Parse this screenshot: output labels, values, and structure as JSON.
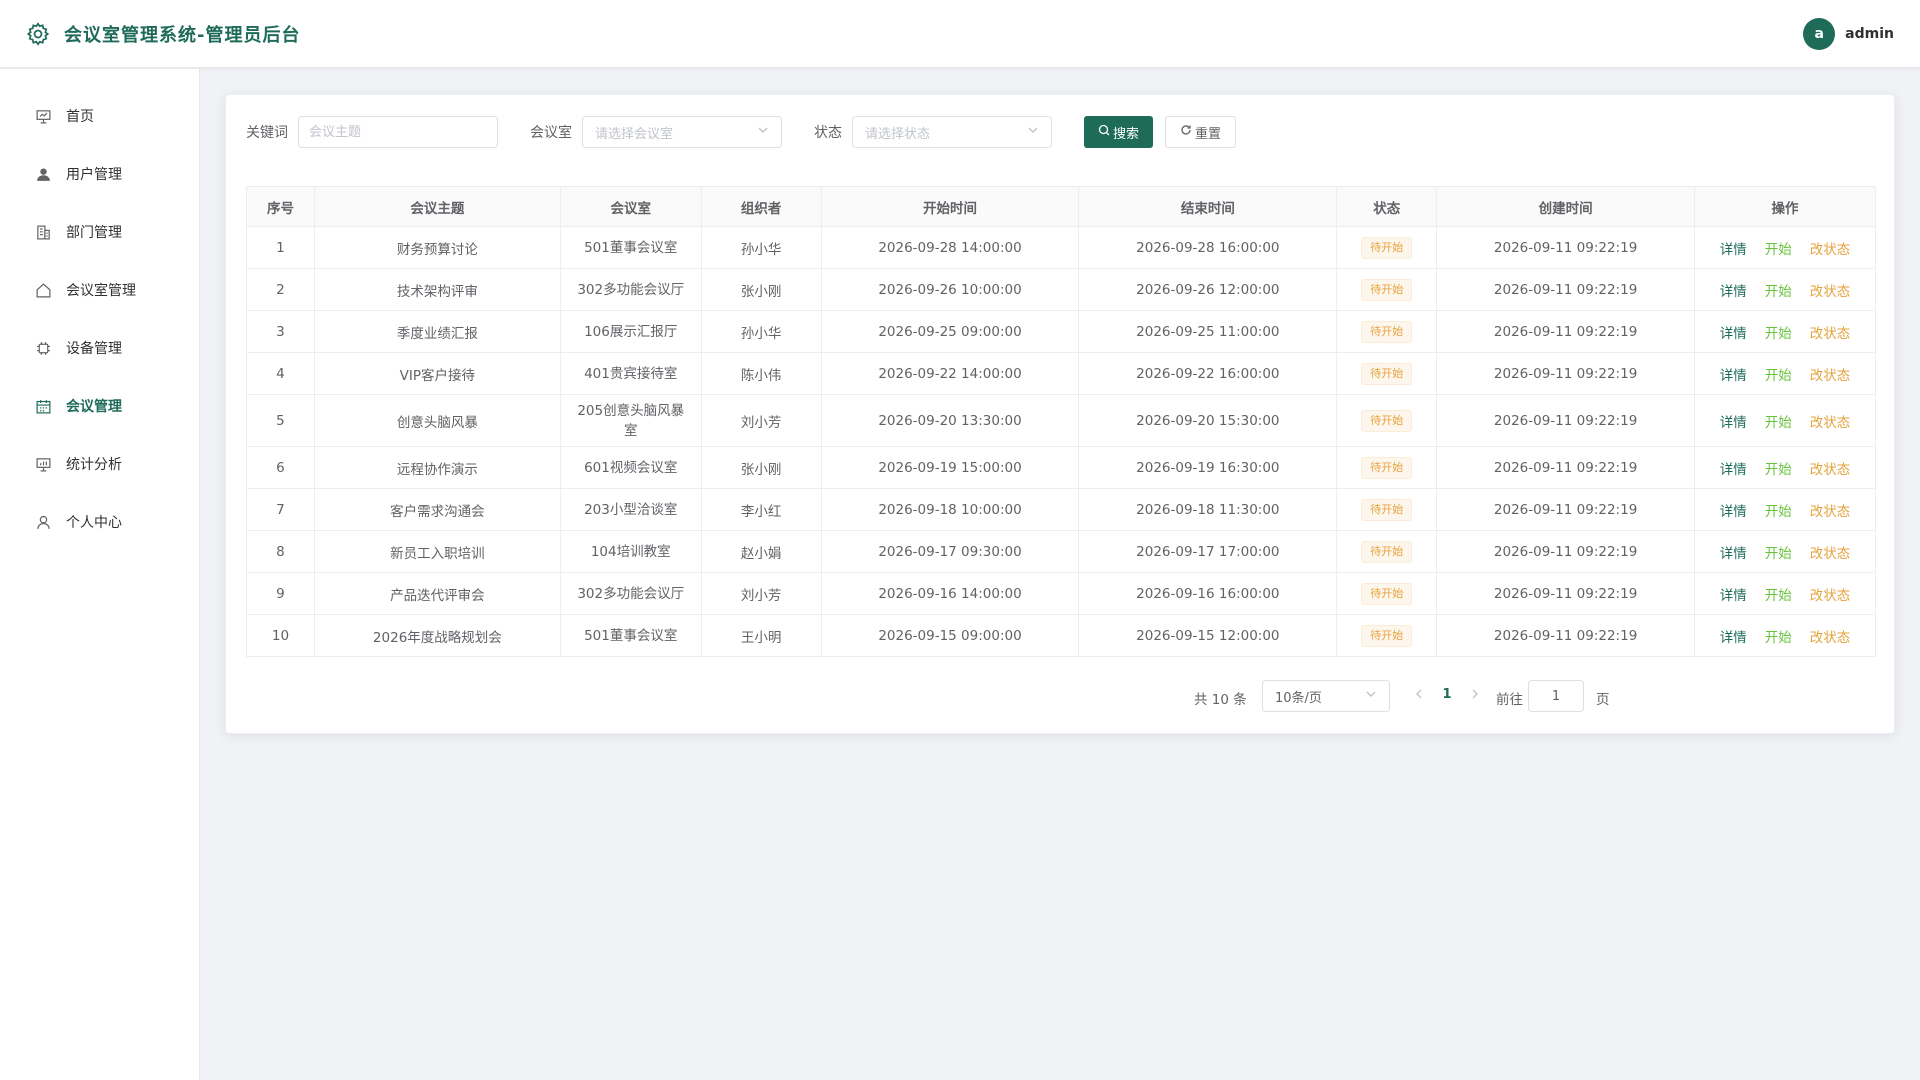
{
  "header": {
    "title": "会议室管理系统-管理员后台",
    "avatar_letter": "a",
    "username": "admin",
    "brand_color": "#1f6b5a"
  },
  "sidebar": {
    "items": [
      {
        "label": "首页",
        "icon": "presentation-icon"
      },
      {
        "label": "用户管理",
        "icon": "user-icon"
      },
      {
        "label": "部门管理",
        "icon": "building-icon"
      },
      {
        "label": "会议室管理",
        "icon": "home-icon"
      },
      {
        "label": "设备管理",
        "icon": "chip-icon"
      },
      {
        "label": "会议管理",
        "icon": "calendar-icon",
        "active": true
      },
      {
        "label": "统计分析",
        "icon": "chart-board-icon"
      },
      {
        "label": "个人中心",
        "icon": "person-icon"
      }
    ]
  },
  "filters": {
    "keyword_label": "关键词",
    "keyword_placeholder": "会议主题",
    "room_label": "会议室",
    "room_placeholder": "请选择会议室",
    "status_label": "状态",
    "status_placeholder": "请选择状态",
    "search_label": "搜索",
    "reset_label": "重置"
  },
  "table": {
    "headers": [
      "序号",
      "会议主题",
      "会议室",
      "组织者",
      "开始时间",
      "结束时间",
      "状态",
      "创建时间",
      "操作"
    ],
    "rows": [
      {
        "no": "1",
        "topic": "财务预算讨论",
        "room": "501董事会议室",
        "organizer": "孙小华",
        "start": "2026-09-28 14:00:00",
        "end": "2026-09-28 16:00:00",
        "status": "待开始",
        "created": "2026-09-11 09:22:19"
      },
      {
        "no": "2",
        "topic": "技术架构评审",
        "room": "302多功能会议厅",
        "organizer": "张小刚",
        "start": "2026-09-26 10:00:00",
        "end": "2026-09-26 12:00:00",
        "status": "待开始",
        "created": "2026-09-11 09:22:19"
      },
      {
        "no": "3",
        "topic": "季度业绩汇报",
        "room": "106展示汇报厅",
        "organizer": "孙小华",
        "start": "2026-09-25 09:00:00",
        "end": "2026-09-25 11:00:00",
        "status": "待开始",
        "created": "2026-09-11 09:22:19"
      },
      {
        "no": "4",
        "topic": "VIP客户接待",
        "room": "401贵宾接待室",
        "organizer": "陈小伟",
        "start": "2026-09-22 14:00:00",
        "end": "2026-09-22 16:00:00",
        "status": "待开始",
        "created": "2026-09-11 09:22:19"
      },
      {
        "no": "5",
        "topic": "创意头脑风暴",
        "room": "205创意头脑风暴室",
        "organizer": "刘小芳",
        "start": "2026-09-20 13:30:00",
        "end": "2026-09-20 15:30:00",
        "status": "待开始",
        "created": "2026-09-11 09:22:19"
      },
      {
        "no": "6",
        "topic": "远程协作演示",
        "room": "601视频会议室",
        "organizer": "张小刚",
        "start": "2026-09-19 15:00:00",
        "end": "2026-09-19 16:30:00",
        "status": "待开始",
        "created": "2026-09-11 09:22:19"
      },
      {
        "no": "7",
        "topic": "客户需求沟通会",
        "room": "203小型洽谈室",
        "organizer": "李小红",
        "start": "2026-09-18 10:00:00",
        "end": "2026-09-18 11:30:00",
        "status": "待开始",
        "created": "2026-09-11 09:22:19"
      },
      {
        "no": "8",
        "topic": "新员工入职培训",
        "room": "104培训教室",
        "organizer": "赵小娟",
        "start": "2026-09-17 09:30:00",
        "end": "2026-09-17 17:00:00",
        "status": "待开始",
        "created": "2026-09-11 09:22:19"
      },
      {
        "no": "9",
        "topic": "产品迭代评审会",
        "room": "302多功能会议厅",
        "organizer": "刘小芳",
        "start": "2026-09-16 14:00:00",
        "end": "2026-09-16 16:00:00",
        "status": "待开始",
        "created": "2026-09-11 09:22:19"
      },
      {
        "no": "10",
        "topic": "2026年度战略规划会",
        "room": "501董事会议室",
        "organizer": "王小明",
        "start": "2026-09-15 09:00:00",
        "end": "2026-09-15 12:00:00",
        "status": "待开始",
        "created": "2026-09-11 09:22:19"
      }
    ],
    "actions": {
      "detail": "详情",
      "start": "开始",
      "change": "改状态"
    }
  },
  "pagination": {
    "total": "共 10 条",
    "page_size": "10条/页",
    "current": "1",
    "goto_label": "前往",
    "goto_value": "1",
    "page_suffix": "页"
  }
}
